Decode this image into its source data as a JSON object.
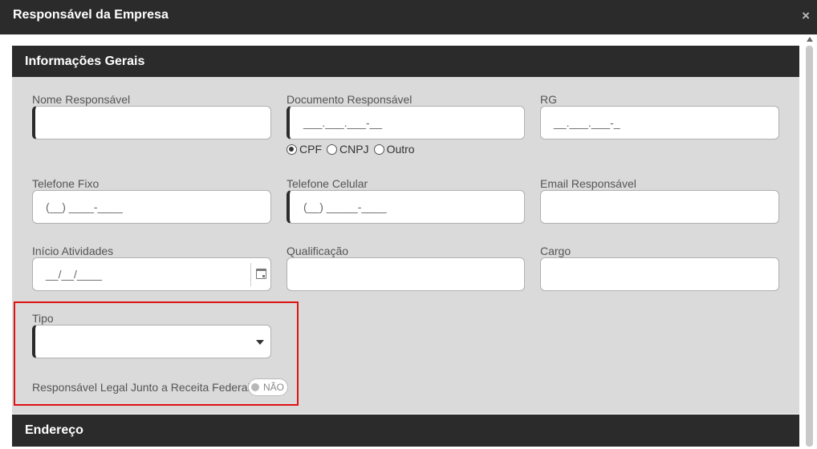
{
  "dialog": {
    "title": "Responsável da Empresa",
    "close_glyph": "×"
  },
  "sections": {
    "general": "Informações Gerais",
    "address": "Endereço"
  },
  "fields": {
    "nome": {
      "label": "Nome Responsável",
      "value": ""
    },
    "documento": {
      "label": "Documento Responsável",
      "mask": "___.___.___-__"
    },
    "rg": {
      "label": "RG",
      "mask": "__.___.___-_"
    },
    "telefone_fixo": {
      "label": "Telefone Fixo",
      "mask": "(__) ____-____"
    },
    "telefone_celular": {
      "label": "Telefone Celular",
      "mask": "(__) _____-____"
    },
    "email": {
      "label": "Email Responsável",
      "value": ""
    },
    "inicio": {
      "label": "Início Atividades",
      "mask": "__/__/____",
      "icon": "calendar-icon"
    },
    "qualificacao": {
      "label": "Qualificação",
      "value": ""
    },
    "cargo": {
      "label": "Cargo",
      "value": ""
    },
    "tipo": {
      "label": "Tipo",
      "value": ""
    }
  },
  "doc_type": {
    "options": [
      "CPF",
      "CNPJ",
      "Outro"
    ],
    "selected": "CPF"
  },
  "legal": {
    "label": "Responsável Legal Junto a Receita Federal",
    "toggle_text": "NÃO",
    "on": false
  },
  "colors": {
    "header_bg": "#2b2b2b",
    "panel_bg": "#dadada",
    "highlight": "#e01010"
  }
}
